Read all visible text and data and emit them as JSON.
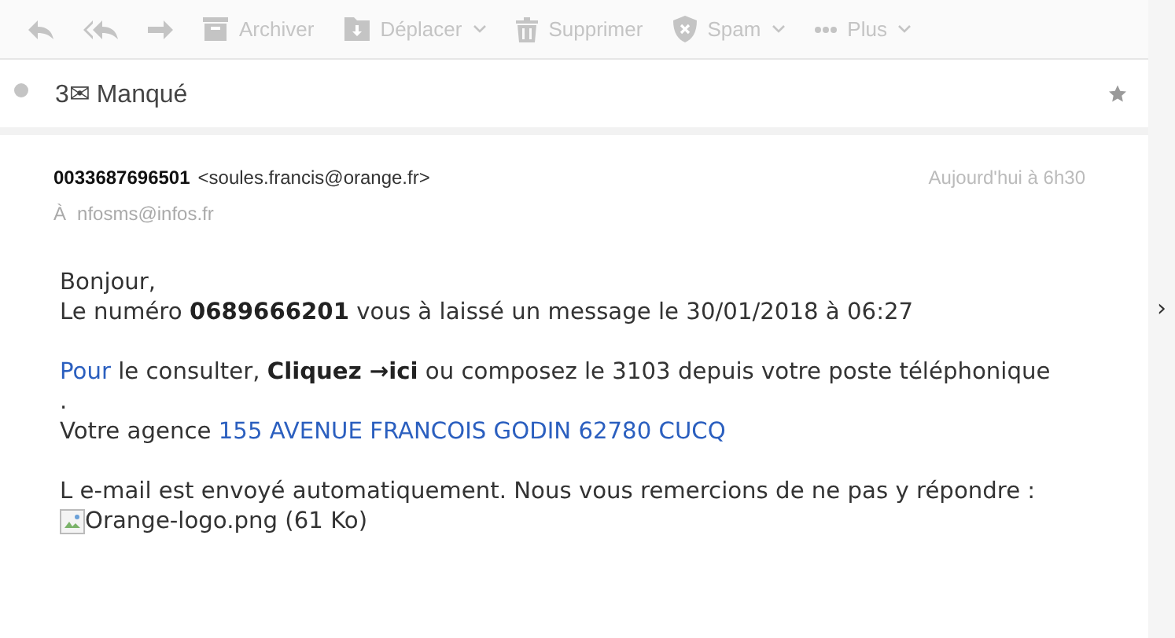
{
  "toolbar": [
    {
      "kind": "reply"
    },
    {
      "kind": "reply_all"
    },
    {
      "kind": "forward"
    },
    {
      "kind": "archive",
      "label": "Archiver"
    },
    {
      "kind": "move",
      "label": "Déplacer",
      "dropdown": true
    },
    {
      "kind": "delete",
      "label": "Supprimer"
    },
    {
      "kind": "spam",
      "label": "Spam",
      "dropdown": true
    },
    {
      "kind": "more",
      "label": "Plus",
      "dropdown": true
    }
  ],
  "subject": {
    "text": "3✉ Manqué",
    "unread": true,
    "starred": false
  },
  "header": {
    "sender_name": "0033687696501",
    "sender_email": "<soules.francis@orange.fr>",
    "date": "Aujourd'hui à 6h30",
    "to_label": "À",
    "to": "nfosms@infos.fr"
  },
  "body": {
    "greeting": "Bonjour,",
    "message": "Le numéro **0689666201** vous à laissé un message le 30/01/2018 à 06:27",
    "link_pour": "Pour",
    "consult": " le consulter, **Cliquez →ici** ou composez le 3103 depuis votre poste téléphonique\n.",
    "agency_label": "Votre agence ",
    "agency_address": "155 AVENUE FRANCOIS GODIN 62780 CUCQ",
    "notice": "L e-mail est envoyé automatiquement. Nous vous remercions de ne pas y répondre :",
    "attachment": "Orange-logo.png (61 Ko)"
  },
  "side_arrow": "›"
}
